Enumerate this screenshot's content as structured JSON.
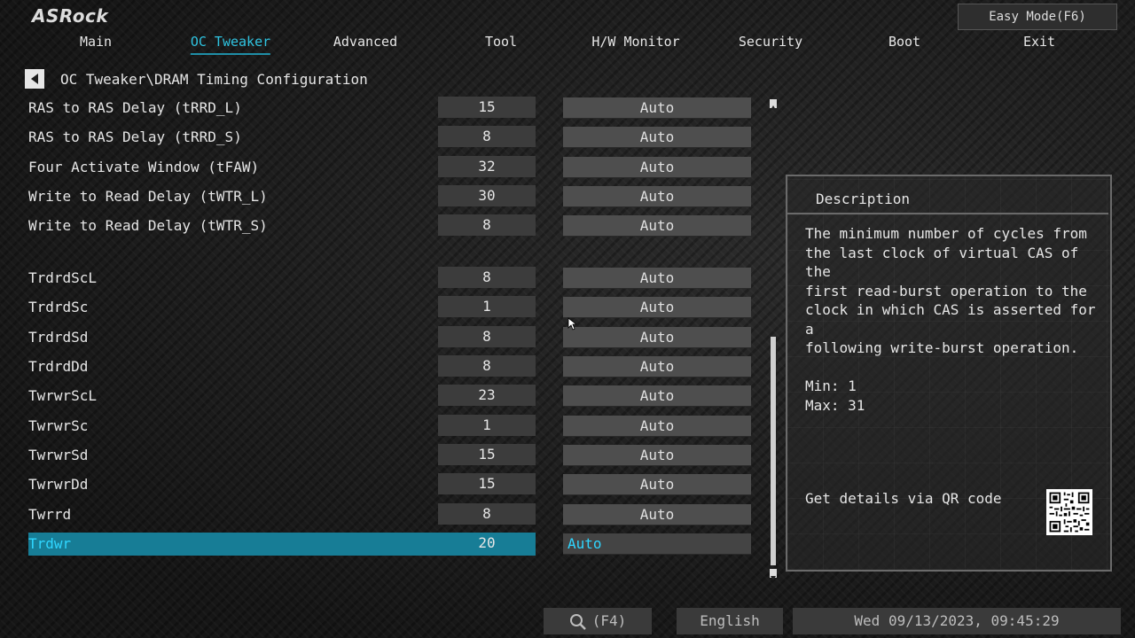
{
  "brand": "ASRock",
  "easy_mode_label": "Easy Mode(F6)",
  "nav": {
    "tabs": [
      "Main",
      "OC Tweaker",
      "Advanced",
      "Tool",
      "H/W Monitor",
      "Security",
      "Boot",
      "Exit"
    ],
    "active": "OC Tweaker"
  },
  "breadcrumb": "OC Tweaker\\DRAM Timing Configuration",
  "rows": [
    {
      "label": "RAS to RAS Delay (tRRD_L)",
      "value": "15",
      "setting": "Auto"
    },
    {
      "label": "RAS to RAS Delay (tRRD_S)",
      "value": "8",
      "setting": "Auto"
    },
    {
      "label": "Four Activate Window (tFAW)",
      "value": "32",
      "setting": "Auto"
    },
    {
      "label": "Write to Read Delay (tWTR_L)",
      "value": "30",
      "setting": "Auto"
    },
    {
      "label": "Write to Read Delay (tWTR_S)",
      "value": "8",
      "setting": "Auto"
    },
    {
      "label": "TrdrdScL",
      "value": "8",
      "setting": "Auto"
    },
    {
      "label": "TrdrdSc",
      "value": "1",
      "setting": "Auto"
    },
    {
      "label": "TrdrdSd",
      "value": "8",
      "setting": "Auto"
    },
    {
      "label": "TrdrdDd",
      "value": "8",
      "setting": "Auto"
    },
    {
      "label": "TwrwrScL",
      "value": "23",
      "setting": "Auto"
    },
    {
      "label": "TwrwrSc",
      "value": "1",
      "setting": "Auto"
    },
    {
      "label": "TwrwrSd",
      "value": "15",
      "setting": "Auto"
    },
    {
      "label": "TwrwrDd",
      "value": "15",
      "setting": "Auto"
    },
    {
      "label": "Twrrd",
      "value": "8",
      "setting": "Auto"
    },
    {
      "label": "Trdwr",
      "value": "20",
      "setting": "Auto"
    }
  ],
  "selected_row": "Trdwr",
  "description": {
    "title": "Description",
    "text": "The minimum number of cycles from\nthe last clock of virtual CAS of the\nfirst read-burst operation to the\nclock in which CAS is asserted for a\nfollowing write-burst operation.\n\nMin: 1\nMax: 31",
    "qr_text": "Get details via QR code"
  },
  "bottom": {
    "search_label": "(F4)",
    "language": "English",
    "datetime": "Wed 09/13/2023, 09:45:29"
  },
  "colors": {
    "accent": "#2fc3e0",
    "selected_bg": "#177d96",
    "background": "#1c1c1c"
  }
}
